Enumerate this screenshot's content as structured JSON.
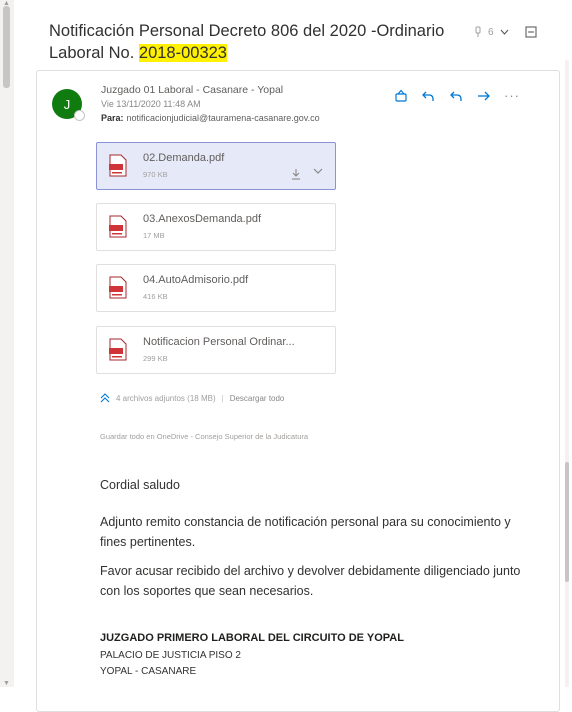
{
  "subject": {
    "line1": "Notificación Personal Decreto 806 del 2020 -Ordinario",
    "line2_prefix": "Laboral No. ",
    "line2_highlight": "2018-00323",
    "count": "6"
  },
  "message": {
    "avatar_initial": "J",
    "sender": "Juzgado 01 Laboral - Casanare - Yopal",
    "date": "Vie 13/11/2020 11:48 AM",
    "to_label": "Para:",
    "to_value": "notificacionjudicial@tauramena-casanare.gov.co"
  },
  "attachments": [
    {
      "name": "02.Demanda.pdf",
      "size": "970 KB"
    },
    {
      "name": "03.AnexosDemanda.pdf",
      "size": "17 MB"
    },
    {
      "name": "04.AutoAdmisorio.pdf",
      "size": "416 KB"
    },
    {
      "name": "Notificacion Personal Ordinar...",
      "size": "299 KB"
    }
  ],
  "attachments_summary": "4 archivos adjuntos (18 MB)",
  "download_all": "Descargar todo",
  "save_onedrive": "Guardar todo en OneDrive - Consejo Superior de la Judicatura",
  "body": {
    "greeting": "Cordial saludo",
    "p1": "Adjunto remito constancia de notificación personal para su conocimiento y fines pertinentes.",
    "p2": "Favor acusar recibido del archivo y devolver debidamente diligenciado junto con los soportes que sean necesarios.",
    "sig1": "JUZGADO PRIMERO LABORAL DEL CIRCUITO DE YOPAL",
    "sig2": "PALACIO DE JUSTICIA PISO 2",
    "sig3": "YOPAL - CASANARE"
  },
  "colors": {
    "accent": "#0078d4",
    "avatar": "#107c10",
    "highlight": "#fff100",
    "selected": "#e6e9f8"
  },
  "icons": [
    "pin-icon",
    "chevron-down-icon",
    "more-window-icon",
    "emoji-icon",
    "reply-icon",
    "reply-all-icon",
    "forward-icon",
    "more-icon",
    "pdf-icon",
    "download-icon",
    "collapse-icon"
  ]
}
